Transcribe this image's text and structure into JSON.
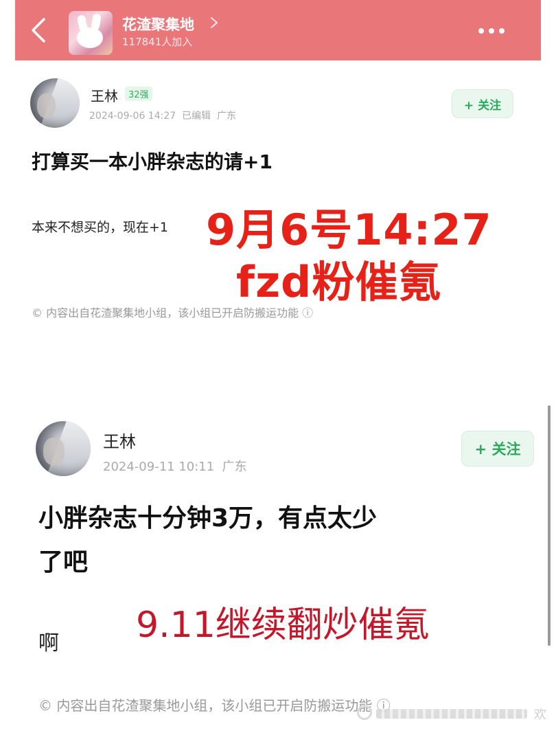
{
  "header": {
    "group_name": "花渣聚集地",
    "member_count": "117841人加入",
    "background": "#e9777a"
  },
  "post1": {
    "username": "王林",
    "level_badge": "32强",
    "meta": "2024-09-06 14:27  已编辑  广东",
    "follow_label": "+ 关注",
    "title": "打算买一本小胖杂志的请+1",
    "body": "本来不想买的，现在+1",
    "overlay_line1": "9月6号14:27",
    "overlay_line2": "fzd粉催氪",
    "copyright": "© 内容出自花渣聚集地小组，该小组已开启防搬运功能 ⓘ"
  },
  "post2": {
    "username": "王林",
    "meta": "2024-09-11 10:11  广东",
    "follow_label": "+ 关注",
    "title_line1": "小胖杂志十分钟3万，有点太少",
    "title_line2": "了吧",
    "body": "啊",
    "overlay": "9.11继续翻炒催氪",
    "copyright": "© 内容出自花渣聚集地小组，该小组已开启防搬运功能 ⓘ"
  },
  "watermark": {
    "tail_text": "欢"
  },
  "colors": {
    "follow_green": "#2ba85a",
    "overlay_red": "#e62117",
    "overlay_darkred": "#c4182a"
  },
  "icons": {
    "back": "chevron-left-icon",
    "group_link": "chevron-right-icon",
    "more": "more-horizontal-icon"
  }
}
